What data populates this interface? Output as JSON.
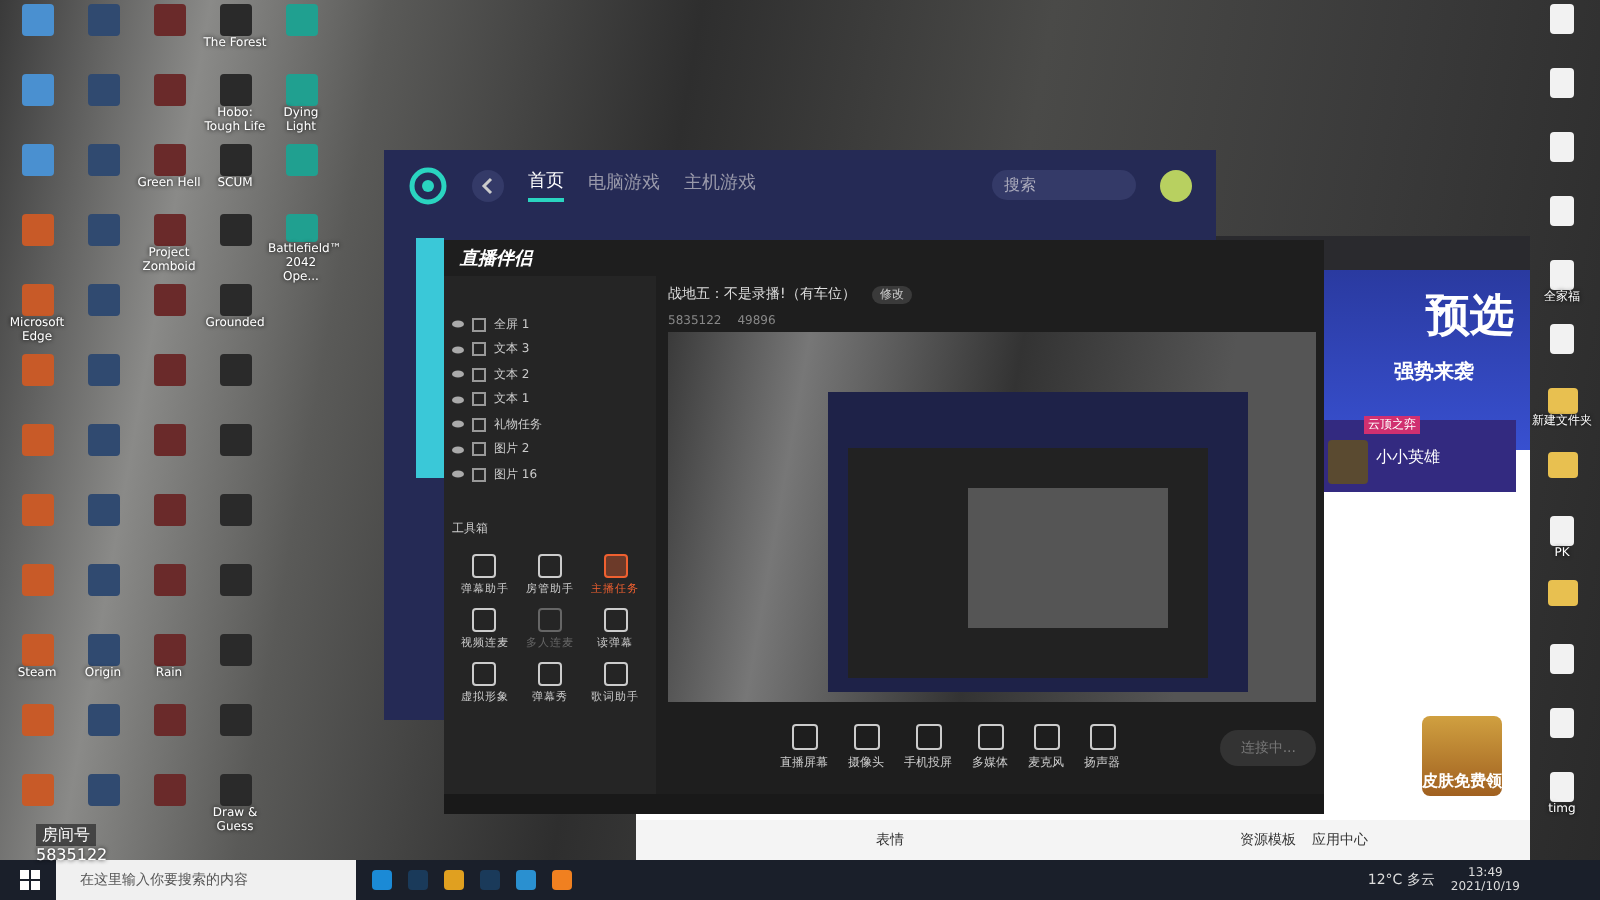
{
  "desktop_left": [
    [
      {
        "kind": "system"
      },
      {
        "kind": "system"
      },
      {
        "kind": "system"
      },
      {
        "kind": "shortcut"
      },
      {
        "kind": "shortcut",
        "label": "Microsoft Edge"
      },
      {
        "kind": "shortcut"
      },
      {
        "kind": "shortcut"
      },
      {
        "kind": "shortcut"
      },
      {
        "kind": "shortcut"
      },
      {
        "kind": "shortcut",
        "label": "Steam"
      },
      {
        "kind": "shortcut"
      },
      {
        "kind": "shortcut"
      }
    ],
    [
      {
        "kind": "shortcut"
      },
      {
        "kind": "shortcut"
      },
      {
        "kind": "shortcut"
      },
      {
        "kind": "shortcut"
      },
      {
        "kind": "shortcut"
      },
      {
        "kind": "shortcut"
      },
      {
        "kind": "shortcut"
      },
      {
        "kind": "shortcut"
      },
      {
        "kind": "shortcut"
      },
      {
        "kind": "shortcut",
        "label": "Origin"
      },
      {
        "kind": "shortcut"
      },
      {
        "kind": "shortcut"
      }
    ],
    [
      {
        "kind": "shortcut"
      },
      {
        "kind": "shortcut"
      },
      {
        "kind": "shortcut",
        "label": "Green Hell"
      },
      {
        "kind": "shortcut",
        "label": "Project Zomboid"
      },
      {
        "kind": "shortcut"
      },
      {
        "kind": "shortcut"
      },
      {
        "kind": "shortcut"
      },
      {
        "kind": "shortcut"
      },
      {
        "kind": "shortcut"
      },
      {
        "kind": "shortcut",
        "label": "Rain"
      },
      {
        "kind": "shortcut"
      },
      {
        "kind": "shortcut"
      }
    ],
    [
      {
        "kind": "shortcut",
        "label": "The Forest"
      },
      {
        "kind": "shortcut",
        "label": "Hobo: Tough Life"
      },
      {
        "kind": "shortcut",
        "label": "SCUM"
      },
      {
        "kind": "shortcut"
      },
      {
        "kind": "shortcut",
        "label": "Grounded"
      },
      {
        "kind": "shortcut"
      },
      {
        "kind": "shortcut"
      },
      {
        "kind": "shortcut"
      },
      {
        "kind": "shortcut"
      },
      {
        "kind": "shortcut"
      },
      {
        "kind": "shortcut"
      },
      {
        "kind": "shortcut",
        "label": "Draw & Guess"
      }
    ],
    [
      {
        "kind": "shortcut"
      },
      {
        "kind": "shortcut",
        "label": "Dying Light"
      },
      {
        "kind": "shortcut"
      },
      {
        "kind": "shortcut",
        "label": "Battlefield™ 2042 Ope..."
      }
    ]
  ],
  "desktop_right": [
    {
      "kind": "file"
    },
    {
      "kind": "file"
    },
    {
      "kind": "file"
    },
    {
      "kind": "file"
    },
    {
      "kind": "file",
      "label": "全家福"
    },
    {
      "kind": "file"
    },
    {
      "kind": "folder",
      "label": "新建文件夹"
    },
    {
      "kind": "folder"
    },
    {
      "kind": "file",
      "label": "PK"
    },
    {
      "kind": "folder"
    },
    {
      "kind": "file"
    },
    {
      "kind": "file"
    },
    {
      "kind": "file",
      "label": "timg"
    }
  ],
  "game_client": {
    "tabs": [
      {
        "label": "首页",
        "selected": true
      },
      {
        "label": "电脑游戏",
        "selected": false
      },
      {
        "label": "主机游戏",
        "selected": false
      }
    ],
    "search": {
      "placeholder": "搜索"
    }
  },
  "browser": {
    "banner_title": "预选",
    "banner_subtitle": "强势来袭",
    "card_tag": "云顶之弈",
    "card_title": "小小英雄",
    "promo": "皮肤免费领",
    "chat_bar": [
      {
        "label": "表情"
      },
      {
        "label": "资源模板"
      },
      {
        "label": "应用中心"
      }
    ]
  },
  "live_app": {
    "logo": "直播伴侣",
    "scenes": [
      {
        "label": "全屏 1"
      },
      {
        "label": "文本 3"
      },
      {
        "label": "文本 2"
      },
      {
        "label": "文本 1"
      },
      {
        "label": "礼物任务"
      },
      {
        "label": "图片 2"
      },
      {
        "label": "图片 16"
      }
    ],
    "stream_title": "战地五：不是录播!（有车位）",
    "edit_button": "修改",
    "room_number": "5835122",
    "viewers": "49896",
    "toolbox_title": "工具箱",
    "tools": [
      {
        "label": "弹幕助手",
        "selected": false,
        "disabled": false
      },
      {
        "label": "房管助手",
        "selected": false,
        "disabled": false
      },
      {
        "label": "主播任务",
        "selected": true,
        "disabled": false
      },
      {
        "label": "视频连麦",
        "selected": false,
        "disabled": false
      },
      {
        "label": "多人连麦",
        "selected": false,
        "disabled": true
      },
      {
        "label": "读弹幕",
        "selected": false,
        "disabled": false
      },
      {
        "label": "虚拟形象",
        "selected": false,
        "disabled": false
      },
      {
        "label": "弹幕秀",
        "selected": false,
        "disabled": false
      },
      {
        "label": "歌词助手",
        "selected": false,
        "disabled": false
      }
    ],
    "sources": [
      {
        "label": "直播屏幕"
      },
      {
        "label": "摄像头"
      },
      {
        "label": "手机投屏"
      },
      {
        "label": "多媒体"
      },
      {
        "label": "麦克风"
      },
      {
        "label": "扬声器"
      }
    ],
    "start_button": "连接中..."
  },
  "overlay": {
    "title": "房间号",
    "number": "5835122"
  },
  "taskbar": {
    "search": {
      "placeholder": "在这里输入你要搜索的内容"
    },
    "weather": "12°C 多云",
    "time": "13:49",
    "date": "2021/10/19"
  }
}
